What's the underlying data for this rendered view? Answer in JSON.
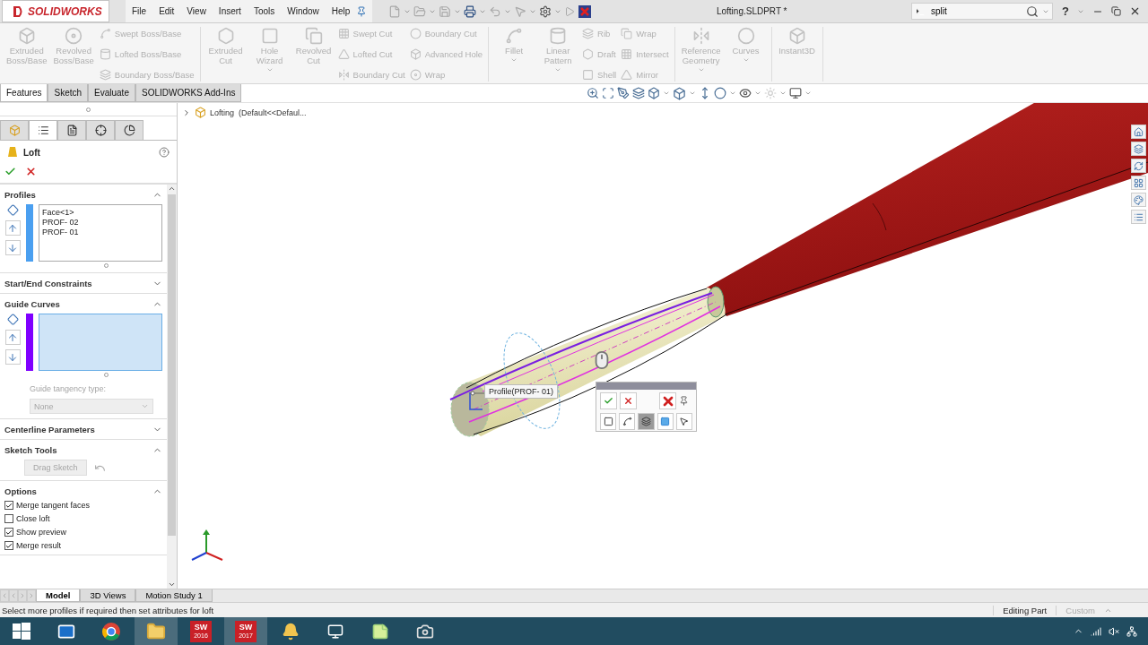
{
  "app": {
    "logo": "SOLIDWORKS",
    "document_title": "Lofting.SLDPRT *",
    "help": "?"
  },
  "menu": [
    "File",
    "Edit",
    "View",
    "Insert",
    "Tools",
    "Window",
    "Help"
  ],
  "search": {
    "value": "split"
  },
  "ribbon": [
    {
      "commands": [
        {
          "kind": "large",
          "label": "Extruded\nBoss/Base",
          "disabled": true,
          "dropdown": false
        },
        {
          "kind": "large",
          "label": "Revolved\nBoss/Base",
          "disabled": true,
          "dropdown": false
        },
        {
          "kind": "column",
          "items": [
            {
              "label": "Swept Boss/Base",
              "disabled": true
            },
            {
              "label": "Lofted Boss/Base",
              "disabled": true
            },
            {
              "label": "Boundary Boss/Base",
              "disabled": true
            }
          ]
        }
      ]
    },
    {
      "commands": [
        {
          "kind": "large",
          "label": "Extruded\nCut",
          "disabled": true,
          "dropdown": false
        },
        {
          "kind": "large",
          "label": "Hole\nWizard",
          "disabled": true,
          "dropdown": true
        },
        {
          "kind": "large",
          "label": "Revolved\nCut",
          "disabled": true,
          "dropdown": false
        },
        {
          "kind": "column",
          "items": [
            {
              "label": "Swept Cut",
              "disabled": true
            },
            {
              "label": "Lofted Cut",
              "disabled": true
            },
            {
              "label": "Boundary Cut",
              "disabled": true
            }
          ]
        },
        {
          "kind": "column",
          "items": [
            {
              "label": "Boundary Cut",
              "disabled": true
            },
            {
              "label": "Advanced Hole",
              "disabled": true
            },
            {
              "label": "Wrap",
              "disabled": true
            }
          ]
        }
      ]
    },
    {
      "commands": [
        {
          "kind": "large",
          "label": "Fillet",
          "disabled": true,
          "dropdown": true
        },
        {
          "kind": "large",
          "label": "Linear\nPattern",
          "disabled": true,
          "dropdown": true
        },
        {
          "kind": "column",
          "items": [
            {
              "label": "Rib",
              "disabled": true
            },
            {
              "label": "Draft",
              "disabled": true
            },
            {
              "label": "Shell",
              "disabled": true
            }
          ]
        },
        {
          "kind": "column",
          "items": [
            {
              "label": "Wrap",
              "disabled": true
            },
            {
              "label": "Intersect",
              "disabled": true
            },
            {
              "label": "Mirror",
              "disabled": true
            }
          ]
        }
      ]
    },
    {
      "commands": [
        {
          "kind": "large",
          "label": "Reference\nGeometry",
          "disabled": true,
          "dropdown": true
        },
        {
          "kind": "large",
          "label": "Curves",
          "disabled": true,
          "dropdown": true
        }
      ]
    },
    {
      "commands": [
        {
          "kind": "large",
          "label": "Instant3D",
          "disabled": true,
          "dropdown": false
        }
      ]
    }
  ],
  "command_tabs": [
    {
      "label": "Features",
      "selected": true
    },
    {
      "label": "Sketch",
      "selected": false
    },
    {
      "label": "Evaluate",
      "selected": false
    },
    {
      "label": "SOLIDWORKS Add-Ins",
      "selected": false
    }
  ],
  "panel_tabs": [
    {
      "selected": false
    },
    {
      "selected": true
    },
    {
      "selected": false
    },
    {
      "selected": false
    },
    {
      "selected": false
    }
  ],
  "property_manager": {
    "title": "Loft",
    "sections": [
      {
        "kind": "selection",
        "title": "Profiles",
        "expanded": true,
        "color": "#4a9ff0",
        "active": false,
        "items": [
          "Face<1>",
          "PROF- 02",
          "PROF- 01"
        ]
      },
      {
        "kind": "header",
        "title": "Start/End Constraints",
        "expanded": false
      },
      {
        "kind": "selection",
        "title": "Guide Curves",
        "expanded": true,
        "color": "#7f00ff",
        "active": true,
        "tangency_label": "Guide tangency type:",
        "tangency_value": "None",
        "tangency_disabled": true
      },
      {
        "kind": "header",
        "title": "Centerline Parameters",
        "expanded": false
      },
      {
        "kind": "tools",
        "title": "Sketch Tools",
        "expanded": true,
        "button": {
          "label": "Drag Sketch",
          "disabled": true
        }
      },
      {
        "kind": "options",
        "title": "Options",
        "expanded": true,
        "checkboxes": [
          {
            "label": "Merge tangent faces",
            "checked": true
          },
          {
            "label": "Close loft",
            "checked": false
          },
          {
            "label": "Show preview",
            "checked": true
          },
          {
            "label": "Merge result",
            "checked": true
          }
        ]
      }
    ]
  },
  "breadcrumb": "Lofting  (Default<<Defaul...",
  "callout": "Profile(PROF- 01)",
  "popup_toolbar": {
    "shape_tools": [
      {
        "selected": false
      },
      {
        "selected": false
      },
      {
        "selected": true
      },
      {
        "selected": false
      },
      {
        "selected": false
      }
    ]
  },
  "bottom_tabs": [
    {
      "label": "Model",
      "selected": true
    },
    {
      "label": "3D Views",
      "selected": false
    },
    {
      "label": "Motion Study 1",
      "selected": false
    }
  ],
  "status_bar": {
    "message": "Select more profiles if required then set attributes for loft",
    "mode": "Editing Part",
    "units": "Custom"
  },
  "taskbar": [
    {
      "kind": "start",
      "selected": false
    },
    {
      "kind": "mail",
      "selected": false
    },
    {
      "kind": "browser",
      "selected": false
    },
    {
      "kind": "folder",
      "selected": true
    },
    {
      "kind": "sw",
      "letters": "SW",
      "version": "2016",
      "selected": false
    },
    {
      "kind": "sw",
      "letters": "SW",
      "version": "2017",
      "selected": true
    },
    {
      "kind": "help",
      "selected": false
    },
    {
      "kind": "recorder",
      "selected": false
    },
    {
      "kind": "notes",
      "selected": false
    },
    {
      "kind": "capture",
      "selected": false
    }
  ]
}
